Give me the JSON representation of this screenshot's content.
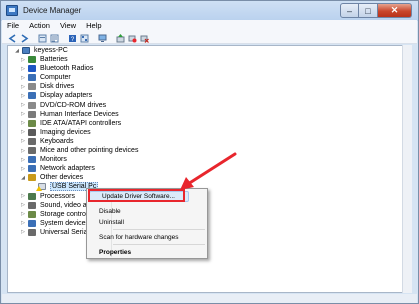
{
  "window": {
    "title": "Device Manager"
  },
  "menu": [
    "File",
    "Action",
    "View",
    "Help"
  ],
  "tree": {
    "root": "keyess-PC",
    "items": [
      {
        "label": "Batteries",
        "icon": "battery-icon",
        "color": "#3a8a3a"
      },
      {
        "label": "Bluetooth Radios",
        "icon": "bluetooth-icon",
        "color": "#1d56c4"
      },
      {
        "label": "Computer",
        "icon": "computer-icon",
        "color": "#3b6fb6"
      },
      {
        "label": "Disk drives",
        "icon": "disk-drive-icon",
        "color": "#8a8a8a"
      },
      {
        "label": "Display adapters",
        "icon": "display-adapter-icon",
        "color": "#3b6fb6"
      },
      {
        "label": "DVD/CD-ROM drives",
        "icon": "dvd-drive-icon",
        "color": "#8a8a8a"
      },
      {
        "label": "Human Interface Devices",
        "icon": "hid-icon",
        "color": "#7b7b7b"
      },
      {
        "label": "IDE ATA/ATAPI controllers",
        "icon": "ide-controller-icon",
        "color": "#6c8a47"
      },
      {
        "label": "Imaging devices",
        "icon": "camera-icon",
        "color": "#5a5a5a"
      },
      {
        "label": "Keyboards",
        "icon": "keyboard-icon",
        "color": "#6a6a6a"
      },
      {
        "label": "Mice and other pointing devices",
        "icon": "mouse-icon",
        "color": "#6a6a6a"
      },
      {
        "label": "Monitors",
        "icon": "monitor-icon",
        "color": "#3b6fb6"
      },
      {
        "label": "Network adapters",
        "icon": "network-adapter-icon",
        "color": "#3b6fb6"
      },
      {
        "label": "Other devices",
        "icon": "other-devices-icon",
        "color": "#c99a1b"
      },
      {
        "label": "USB Serial Pc",
        "icon": "warning-device-icon",
        "color": "#e0b21c"
      },
      {
        "label": "Processors",
        "icon": "processor-icon",
        "color": "#4d7a4d"
      },
      {
        "label": "Sound, video an",
        "icon": "sound-icon",
        "color": "#6a6a6a"
      },
      {
        "label": "Storage controll",
        "icon": "storage-controller-icon",
        "color": "#6c8a47"
      },
      {
        "label": "System devices",
        "icon": "system-device-icon",
        "color": "#3b6fb6"
      },
      {
        "label": "Universal Serial",
        "icon": "usb-icon",
        "color": "#6a6a6a"
      }
    ]
  },
  "context_menu": {
    "update": "Update Driver Software...",
    "disable": "Disable",
    "uninstall": "Uninstall",
    "scan": "Scan for hardware changes",
    "properties": "Properties"
  },
  "colors": {
    "annotation": "#e8262d",
    "selection": "#cde8ff"
  }
}
